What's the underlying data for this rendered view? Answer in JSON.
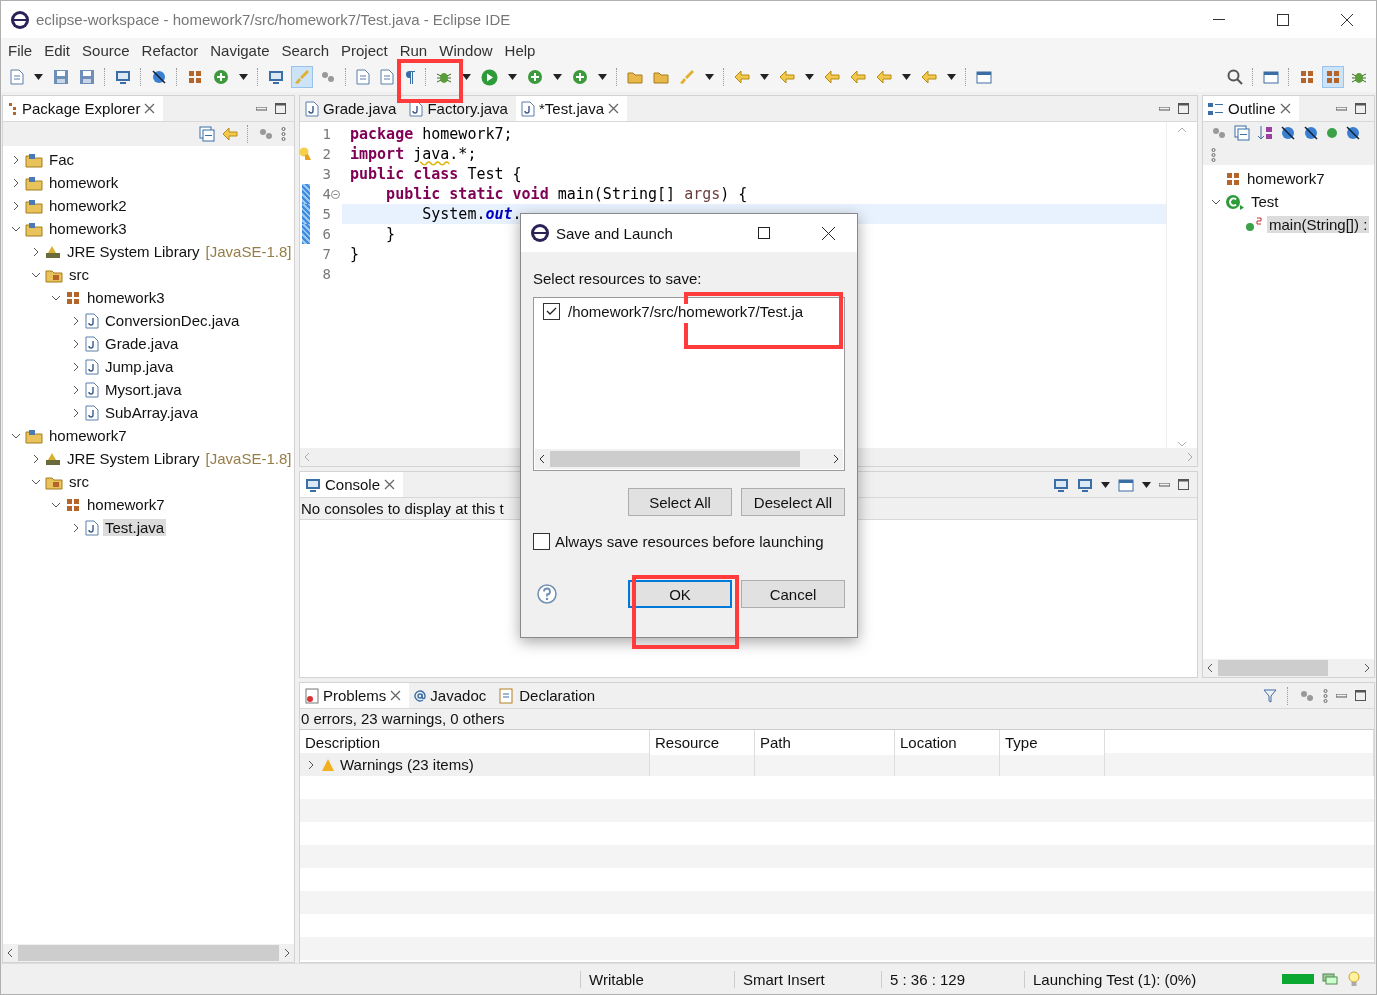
{
  "window": {
    "title": "eclipse-workspace - homework7/src/homework7/Test.java - Eclipse IDE"
  },
  "menu": [
    "File",
    "Edit",
    "Source",
    "Refactor",
    "Navigate",
    "Search",
    "Project",
    "Run",
    "Window",
    "Help"
  ],
  "package_explorer": {
    "title": "Package Explorer",
    "items": [
      {
        "label": "Fac",
        "kind": "project",
        "expanded": false,
        "selected": false
      },
      {
        "label": "homework",
        "kind": "project",
        "expanded": false,
        "selected": false
      },
      {
        "label": "homework2",
        "kind": "project",
        "expanded": false,
        "selected": false
      },
      {
        "label": "homework3",
        "kind": "project",
        "expanded": true,
        "selected": false,
        "children": [
          {
            "label": "JRE System Library",
            "suffix": "[JavaSE-1.8]",
            "kind": "library",
            "expanded": false,
            "selected": false
          },
          {
            "label": "src",
            "kind": "source",
            "expanded": true,
            "selected": false,
            "children": [
              {
                "label": "homework3",
                "kind": "package",
                "expanded": true,
                "selected": false,
                "children": [
                  {
                    "label": "ConversionDec.java",
                    "kind": "file",
                    "expanded": false,
                    "selected": false
                  },
                  {
                    "label": "Grade.java",
                    "kind": "file",
                    "expanded": false,
                    "selected": false
                  },
                  {
                    "label": "Jump.java",
                    "kind": "file",
                    "expanded": false,
                    "selected": false
                  },
                  {
                    "label": "Mysort.java",
                    "kind": "file",
                    "expanded": false,
                    "selected": false
                  },
                  {
                    "label": "SubArray.java",
                    "kind": "file",
                    "expanded": false,
                    "selected": false
                  }
                ]
              }
            ]
          }
        ]
      },
      {
        "label": "homework7",
        "kind": "project",
        "expanded": true,
        "selected": false,
        "children": [
          {
            "label": "JRE System Library",
            "suffix": "[JavaSE-1.8]",
            "kind": "library",
            "expanded": false,
            "selected": false
          },
          {
            "label": "src",
            "kind": "source",
            "expanded": true,
            "selected": false,
            "children": [
              {
                "label": "homework7",
                "kind": "package",
                "expanded": true,
                "selected": false,
                "children": [
                  {
                    "label": "Test.java",
                    "kind": "file",
                    "expanded": false,
                    "selected": true
                  }
                ]
              }
            ]
          }
        ]
      }
    ]
  },
  "editor": {
    "tabs": [
      {
        "label": "Grade.java",
        "selected": false
      },
      {
        "label": "Factory.java",
        "selected": false
      },
      {
        "label": "*Test.java",
        "selected": true
      }
    ],
    "lines": [
      {
        "number": "1",
        "tokens": [
          {
            "text": "package",
            "kind": "keyword"
          },
          {
            "text": " homework7;",
            "kind": "plain"
          }
        ]
      },
      {
        "number": "2",
        "warning": true,
        "tokens": [
          {
            "text": "import ",
            "kind": "keyword"
          },
          {
            "text": "java",
            "kind": "warning"
          },
          {
            "text": ".*;",
            "kind": "plain"
          }
        ]
      },
      {
        "number": "3",
        "tokens": [
          {
            "text": "public class",
            "kind": "keyword"
          },
          {
            "text": " Test {",
            "kind": "plain"
          }
        ]
      },
      {
        "number": "4",
        "changed": true,
        "foldable": true,
        "tokens": [
          {
            "text": "    public static void",
            "kind": "keyword"
          },
          {
            "text": " main(String[] ",
            "kind": "plain"
          },
          {
            "text": "args",
            "kind": "param"
          },
          {
            "text": ") {",
            "kind": "plain"
          }
        ]
      },
      {
        "number": "5",
        "changed": true,
        "current": true,
        "tokens": [
          {
            "text": "        System.",
            "kind": "plain"
          },
          {
            "text": "out",
            "kind": "field"
          },
          {
            "text": ".",
            "kind": "plain"
          }
        ]
      },
      {
        "number": "6",
        "changed": true,
        "tokens": [
          {
            "text": "    }",
            "kind": "plain"
          }
        ]
      },
      {
        "number": "7",
        "tokens": [
          {
            "text": "}",
            "kind": "plain"
          }
        ]
      },
      {
        "number": "8"
      }
    ]
  },
  "console": {
    "title": "Console",
    "message": "No consoles to display at this t"
  },
  "outline": {
    "title": "Outline",
    "items": [
      {
        "label": "homework7",
        "kind": "package",
        "selected": false
      },
      {
        "label": "Test",
        "kind": "class",
        "expanded": true,
        "selected": false,
        "children": [
          {
            "label": "main(String[]) :",
            "kind": "method",
            "selected": true
          }
        ]
      }
    ]
  },
  "problems": {
    "tabs": [
      {
        "label": "Problems",
        "kind": "problems",
        "selected": true
      },
      {
        "label": "Javadoc",
        "kind": "javadoc",
        "selected": false
      },
      {
        "label": "Declaration",
        "kind": "declaration",
        "selected": false
      }
    ],
    "summary": "0 errors, 23 warnings, 0 others",
    "columns": [
      "Description",
      "Resource",
      "Path",
      "Location",
      "Type"
    ],
    "rows": [
      {
        "description": "Warnings (23 items)",
        "expanded": false
      }
    ]
  },
  "dialog": {
    "title": "Save and Launch",
    "prompt": "Select resources to save:",
    "resources": [
      {
        "label": "/homework7/src/homework7/Test.ja",
        "checked": true
      }
    ],
    "select_buttons": [
      "Select All",
      "Deselect All"
    ],
    "always_save": {
      "label": "Always save resources before launching",
      "checked": false
    },
    "buttons": [
      {
        "label": "OK",
        "default": true
      },
      {
        "label": "Cancel",
        "default": false
      }
    ]
  },
  "status_bar": {
    "mode": "Writable",
    "insert": "Smart Insert",
    "position": "5 : 36 : 129",
    "job": "Launching Test (1): (0%)",
    "level": 1
  }
}
